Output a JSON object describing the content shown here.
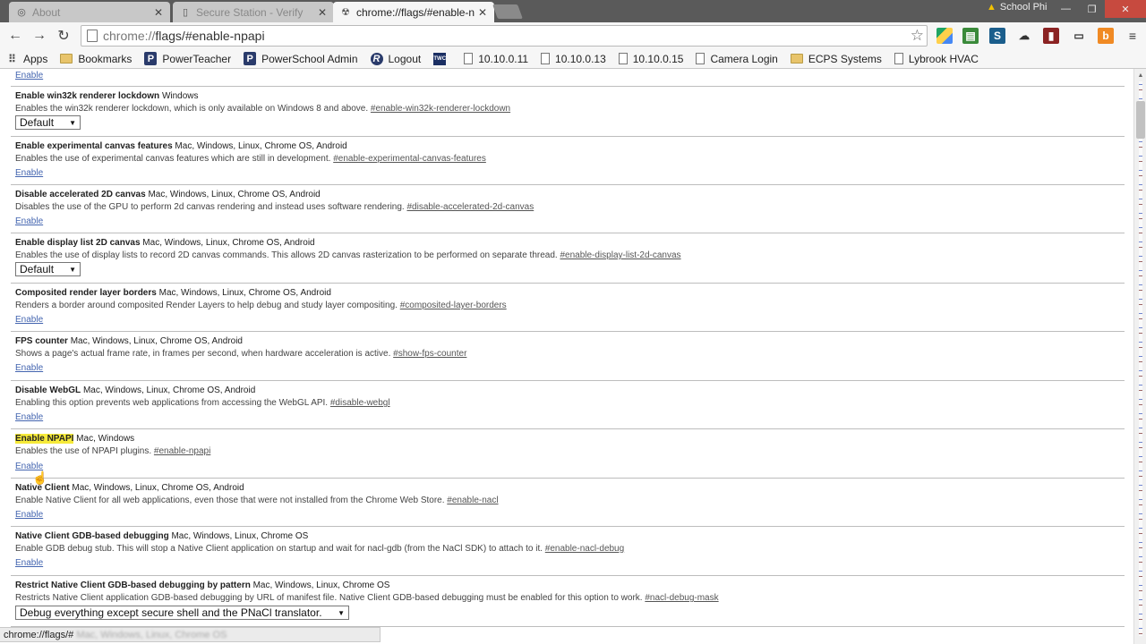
{
  "tabs": [
    {
      "title": "About",
      "active": false
    },
    {
      "title": "Secure Station - Verify",
      "active": false
    },
    {
      "title": "chrome://flags/#enable-n",
      "active": true
    }
  ],
  "profile": {
    "name": "School Phi"
  },
  "omnibox": {
    "url_prefix": "chrome://",
    "url_rest": "flags/#enable-npapi"
  },
  "bookmarks": [
    {
      "label": "Apps",
      "icon": "apps-icon"
    },
    {
      "label": "Bookmarks",
      "icon": "folder-icon"
    },
    {
      "label": "PowerTeacher",
      "icon": "powerschool-icon"
    },
    {
      "label": "PowerSchool Admin",
      "icon": "powerschool-icon"
    },
    {
      "label": "Logout",
      "icon": "r-logo-icon"
    },
    {
      "label": "",
      "icon": "twc-icon"
    },
    {
      "label": "10.10.0.11",
      "icon": "page-icon"
    },
    {
      "label": "10.10.0.13",
      "icon": "page-icon"
    },
    {
      "label": "10.10.0.15",
      "icon": "page-icon"
    },
    {
      "label": "Camera Login",
      "icon": "page-icon"
    },
    {
      "label": "ECPS Systems",
      "icon": "folder-icon"
    },
    {
      "label": "Lybrook HVAC",
      "icon": "page-icon"
    }
  ],
  "flags": [
    {
      "name": "",
      "platforms": "",
      "desc": "",
      "anchor": "",
      "action": "Enable"
    },
    {
      "name": "Enable win32k renderer lockdown",
      "platforms": "Windows",
      "desc": "Enables the win32k renderer lockdown, which is only available on Windows 8 and above.",
      "anchor": "#enable-win32k-renderer-lockdown",
      "select": "Default"
    },
    {
      "name": "Enable experimental canvas features",
      "platforms": "Mac, Windows, Linux, Chrome OS, Android",
      "desc": "Enables the use of experimental canvas features which are still in development.",
      "anchor": "#enable-experimental-canvas-features",
      "action": "Enable"
    },
    {
      "name": "Disable accelerated 2D canvas",
      "platforms": "Mac, Windows, Linux, Chrome OS, Android",
      "desc": "Disables the use of the GPU to perform 2d canvas rendering and instead uses software rendering.",
      "anchor": "#disable-accelerated-2d-canvas",
      "action": "Enable"
    },
    {
      "name": "Enable display list 2D canvas",
      "platforms": "Mac, Windows, Linux, Chrome OS, Android",
      "desc": "Enables the use of display lists to record 2D canvas commands. This allows 2D canvas rasterization to be performed on separate thread.",
      "anchor": "#enable-display-list-2d-canvas",
      "select": "Default"
    },
    {
      "name": "Composited render layer borders",
      "platforms": "Mac, Windows, Linux, Chrome OS, Android",
      "desc": "Renders a border around composited Render Layers to help debug and study layer compositing.",
      "anchor": "#composited-layer-borders",
      "action": "Enable"
    },
    {
      "name": "FPS counter",
      "platforms": "Mac, Windows, Linux, Chrome OS, Android",
      "desc": "Shows a page's actual frame rate, in frames per second, when hardware acceleration is active.",
      "anchor": "#show-fps-counter",
      "action": "Enable"
    },
    {
      "name": "Disable WebGL",
      "platforms": "Mac, Windows, Linux, Chrome OS, Android",
      "desc": "Enabling this option prevents web applications from accessing the WebGL API.",
      "anchor": "#disable-webgl",
      "action": "Enable"
    },
    {
      "name": "Enable NPAPI",
      "platforms": "Mac, Windows",
      "desc": "Enables the use of NPAPI plugins.",
      "anchor": "#enable-npapi",
      "action": "Enable",
      "highlight": true
    },
    {
      "name": "Native Client",
      "platforms": "Mac, Windows, Linux, Chrome OS, Android",
      "desc": "Enable Native Client for all web applications, even those that were not installed from the Chrome Web Store.",
      "anchor": "#enable-nacl",
      "action": "Enable"
    },
    {
      "name": "Native Client GDB-based debugging",
      "platforms": "Mac, Windows, Linux, Chrome OS",
      "desc": "Enable GDB debug stub. This will stop a Native Client application on startup and wait for nacl-gdb (from the NaCl SDK) to attach to it.",
      "anchor": "#enable-nacl-debug",
      "action": "Enable"
    },
    {
      "name": "Restrict Native Client GDB-based debugging by pattern",
      "platforms": "Mac, Windows, Linux, Chrome OS",
      "desc": "Restricts Native Client application GDB-based debugging by URL of manifest file. Native Client GDB-based debugging must be enabled for this option to work.",
      "anchor": "#nacl-debug-mask",
      "select": "Debug everything except secure shell and the PNaCl translator."
    }
  ],
  "status_bar": {
    "url": "chrome://flags/#",
    "trailing": "Mac, Windows, Linux, Chrome OS"
  },
  "colors": {
    "tab_strip": "#5a5a5a",
    "highlight": "#f6ea3a",
    "link": "#4465b0"
  }
}
